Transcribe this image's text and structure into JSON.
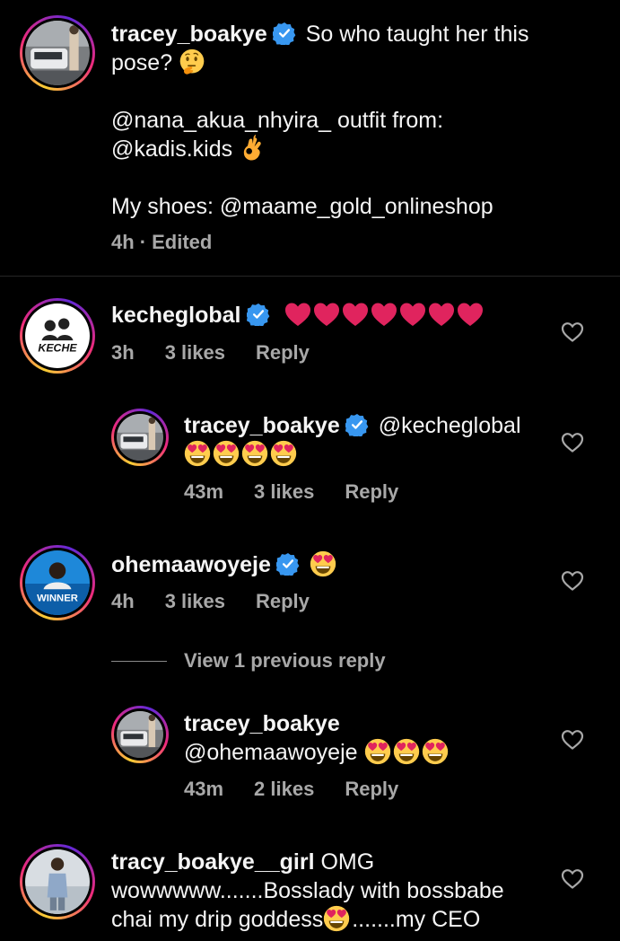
{
  "caption": {
    "username": "tracey_boakye",
    "text_line1": "So who taught her this",
    "text_line2": "pose?",
    "text_line3": "@nana_akua_nhyira_ outfit from:",
    "text_line4": "@kadis.kids",
    "text_line5": "My shoes: @maame_gold_onlineshop",
    "time": "4h",
    "edited": "· Edited"
  },
  "comments": [
    {
      "username": "kecheglobal",
      "avatar_text": "KECHE",
      "time": "3h",
      "likes": "3 likes",
      "reply": "Reply"
    },
    {
      "username": "tracey_boakye",
      "mention": "@kecheglobal",
      "time": "43m",
      "likes": "3 likes",
      "reply": "Reply"
    },
    {
      "username": "ohemaawoyeje",
      "avatar_text": "WINNER",
      "time": "4h",
      "likes": "3 likes",
      "reply": "Reply"
    },
    {
      "view_previous": "View 1 previous reply"
    },
    {
      "username": "tracey_boakye",
      "mention": "@ohemaawoyeje",
      "time": "43m",
      "likes": "2 likes",
      "reply": "Reply"
    },
    {
      "username": "tracy_boakye__girl",
      "text_line1": "OMG",
      "text_line2": "wowwwww.......Bosslady with bossbabe",
      "text_line3": "chai my drip goddess",
      "text_line3b": ".......my CEO"
    }
  ],
  "colors": {
    "background": "#000000",
    "text": "#f5f5f5",
    "meta": "#a8a8a8",
    "verified": "#3897f0",
    "heart_red": "#e0245e"
  },
  "icons": [
    "verified-badge-icon",
    "heart-outline-icon",
    "red-heart-emoji",
    "heart-eyes-emoji",
    "thinking-emoji",
    "ok-hand-emoji"
  ]
}
